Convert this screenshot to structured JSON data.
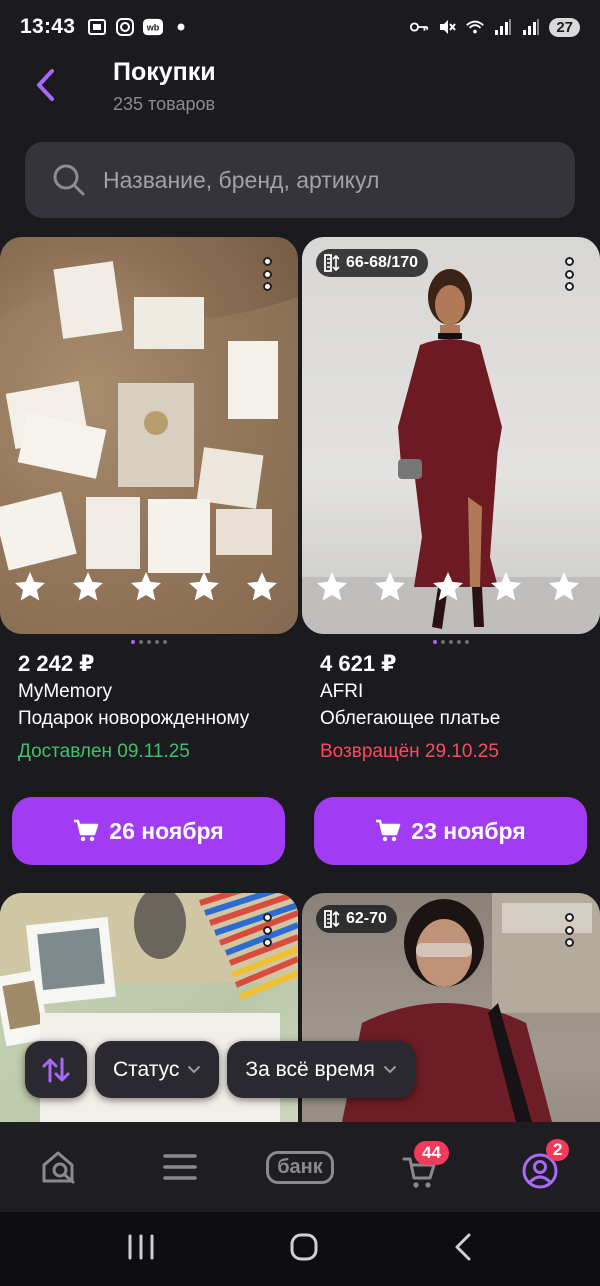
{
  "status_bar": {
    "time": "13:43",
    "battery": "27",
    "icons": [
      "screenshot-icon",
      "instagram-icon",
      "wb-icon",
      "dot-icon",
      "key-icon",
      "mute-icon",
      "wifi-icon",
      "signal-icon",
      "signal-icon"
    ]
  },
  "header": {
    "title": "Покупки",
    "subtitle": "235 товаров"
  },
  "search": {
    "placeholder": "Название, бренд, артикул"
  },
  "products": [
    {
      "price": "2 242 ₽",
      "brand": "MyMemory",
      "name": "Подарок новорожденному",
      "status": "Доставлен 09.11.25",
      "status_color": "#3fc36a",
      "delivery": "26 ноября",
      "size": ""
    },
    {
      "price": "4 621 ₽",
      "brand": "AFRI",
      "name": "Облегающее платье",
      "status": "Возвращён 29.10.25",
      "status_color": "#ff4a5f",
      "delivery": "23 ноября",
      "size": "66-68/170"
    },
    {
      "size": ""
    },
    {
      "size": "62-70"
    }
  ],
  "filters": {
    "status": "Статус",
    "period": "За всё время"
  },
  "bottom_nav": {
    "bank": "банк",
    "cart_badge": "44",
    "profile_badge": "2"
  },
  "colors": {
    "accent": "#a23cf4",
    "background": "#1b1a1f",
    "delivered": "#3fc36a",
    "returned": "#ff4a5f",
    "badge": "#f23a5a"
  }
}
